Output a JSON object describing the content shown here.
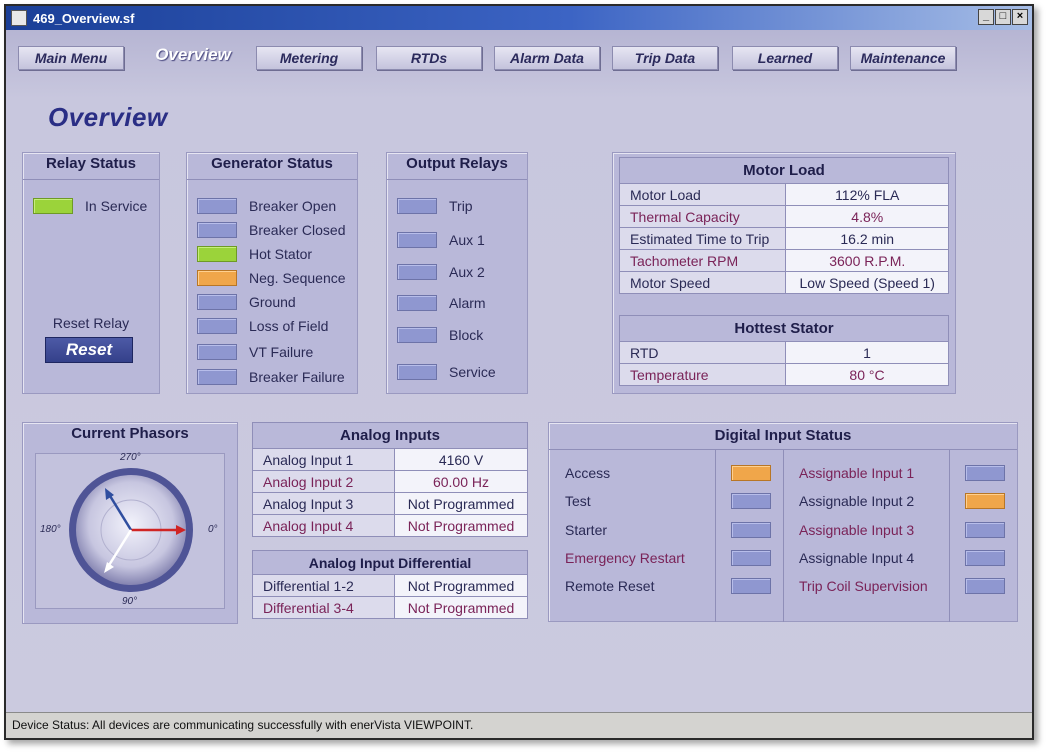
{
  "window": {
    "title": "469_Overview.sf",
    "min": "_",
    "max": "□",
    "close": "×"
  },
  "nav": [
    {
      "label": "Main Menu"
    },
    {
      "label": "Overview"
    },
    {
      "label": "Metering"
    },
    {
      "label": "RTDs"
    },
    {
      "label": "Alarm Data"
    },
    {
      "label": "Trip Data"
    },
    {
      "label": "Learned"
    },
    {
      "label": "Maintenance"
    }
  ],
  "page_title": "Overview",
  "relay_status": {
    "title": "Relay Status",
    "in_service": "In Service",
    "reset_label": "Reset Relay",
    "reset_button": "Reset"
  },
  "generator_status": {
    "title": "Generator Status",
    "items": [
      {
        "label": "Breaker Open",
        "state": "off"
      },
      {
        "label": "Breaker Closed",
        "state": "off"
      },
      {
        "label": "Hot Stator",
        "state": "green"
      },
      {
        "label": "Neg. Sequence",
        "state": "orange"
      },
      {
        "label": "Ground",
        "state": "off"
      },
      {
        "label": "Loss of Field",
        "state": "off"
      },
      {
        "label": "VT Failure",
        "state": "off"
      },
      {
        "label": "Breaker Failure",
        "state": "off"
      }
    ]
  },
  "output_relays": {
    "title": "Output Relays",
    "items": [
      {
        "label": "Trip"
      },
      {
        "label": "Aux 1"
      },
      {
        "label": "Aux 2"
      },
      {
        "label": "Alarm"
      },
      {
        "label": "Block"
      },
      {
        "label": "Service"
      }
    ]
  },
  "motor_load": {
    "title": "Motor Load",
    "rows": [
      {
        "label": "Motor Load",
        "value": "112% FLA"
      },
      {
        "label": "Thermal Capacity",
        "value": "4.8%"
      },
      {
        "label": "Estimated Time to Trip",
        "value": "16.2 min"
      },
      {
        "label": "Tachometer RPM",
        "value": "3600 R.P.M."
      },
      {
        "label": "Motor Speed",
        "value": "Low Speed (Speed 1)"
      }
    ]
  },
  "hottest_stator": {
    "title": "Hottest Stator",
    "rows": [
      {
        "label": "RTD",
        "value": "1"
      },
      {
        "label": "Temperature",
        "value": "80 °C"
      }
    ]
  },
  "current_phasors": {
    "title": "Current Phasors",
    "top": "270°",
    "left": "180°",
    "right": "0°",
    "bottom": "90°"
  },
  "analog_inputs": {
    "title": "Analog Inputs",
    "rows": [
      {
        "label": "Analog Input 1",
        "value": "4160 V"
      },
      {
        "label": "Analog Input 2",
        "value": "60.00 Hz"
      },
      {
        "label": "Analog Input 3",
        "value": "Not Programmed"
      },
      {
        "label": "Analog Input 4",
        "value": "Not Programmed"
      }
    ]
  },
  "analog_differential": {
    "title": "Analog Input Differential",
    "rows": [
      {
        "label": "Differential 1-2",
        "value": "Not Programmed"
      },
      {
        "label": "Differential 3-4",
        "value": "Not Programmed"
      }
    ]
  },
  "digital_inputs": {
    "title": "Digital Input Status",
    "left": [
      {
        "label": "Access",
        "state": "orange"
      },
      {
        "label": "Test",
        "state": "off"
      },
      {
        "label": "Starter",
        "state": "off"
      },
      {
        "label": "Emergency Restart",
        "state": "off"
      },
      {
        "label": "Remote Reset",
        "state": "off"
      }
    ],
    "right": [
      {
        "label": "Assignable Input 1",
        "state": "off"
      },
      {
        "label": "Assignable Input 2",
        "state": "orange"
      },
      {
        "label": "Assignable Input 3",
        "state": "off"
      },
      {
        "label": "Assignable Input 4",
        "state": "off"
      },
      {
        "label": "Trip Coil Supervision",
        "state": "off"
      }
    ]
  },
  "status_bar": "Device Status:  All devices are communicating successfully with enerVista VIEWPOINT."
}
